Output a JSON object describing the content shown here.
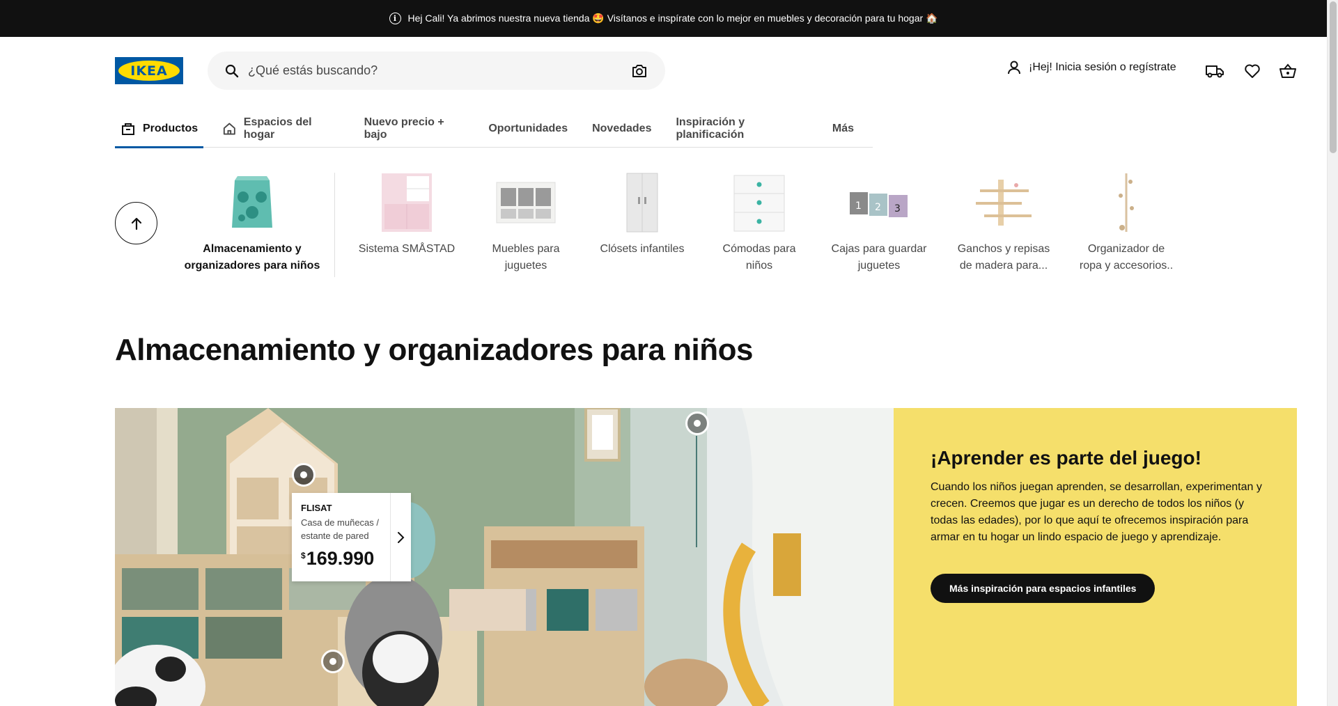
{
  "announcement": {
    "text": "Hej Cali! Ya abrimos nuestra nueva tienda 🤩 Visítanos e inspírate con lo mejor en muebles y decoración para tu hogar 🏠"
  },
  "header": {
    "logo_text": "IKEA",
    "search_placeholder": "¿Qué estás buscando?",
    "account_label": "¡Hej! Inicia sesión o regístrate"
  },
  "nav": {
    "tabs": [
      {
        "label": "Productos",
        "icon": "products-bag-icon"
      },
      {
        "label": "Espacios del hogar",
        "icon": "home-icon"
      },
      {
        "label": "Nuevo precio + bajo"
      },
      {
        "label": "Oportunidades"
      },
      {
        "label": "Novedades"
      },
      {
        "label": "Inspiración y planificación"
      },
      {
        "label": "Más"
      }
    ]
  },
  "categories": {
    "current": {
      "line1": "Almacenamiento y",
      "line2": "organizadores para niños"
    },
    "items": [
      {
        "line1": "Sistema SMÅSTAD",
        "line2": ""
      },
      {
        "line1": "Muebles para",
        "line2": "juguetes"
      },
      {
        "line1": "Clósets infantiles",
        "line2": ""
      },
      {
        "line1": "Cómodas para",
        "line2": "niños"
      },
      {
        "line1": "Cajas para guardar",
        "line2": "juguetes"
      },
      {
        "line1": "Ganchos y repisas",
        "line2": "de madera para..."
      },
      {
        "line1": "Organizador de",
        "line2": "ropa y accesorios.."
      }
    ]
  },
  "page_title": "Almacenamiento y organizadores para niños",
  "product_tag": {
    "name": "FLISAT",
    "desc": "Casa de muñecas / estante de pared",
    "currency": "$",
    "price": "169.990"
  },
  "promo": {
    "title": "¡Aprender es parte del juego!",
    "body": "Cuando los niños juegan aprenden, se desarrollan, experimentan y crecen. Creemos que jugar es un derecho de todos los niños (y todas las edades), por lo que aquí te ofrecemos inspiración para armar en tu hogar un lindo espacio de juego y aprendizaje.",
    "cta": "Más inspiración para espacios infantiles"
  },
  "colors": {
    "brand_blue": "#0058a3",
    "brand_yellow": "#ffdb00",
    "promo_bg": "#f5df6b",
    "topbar": "#111111"
  }
}
